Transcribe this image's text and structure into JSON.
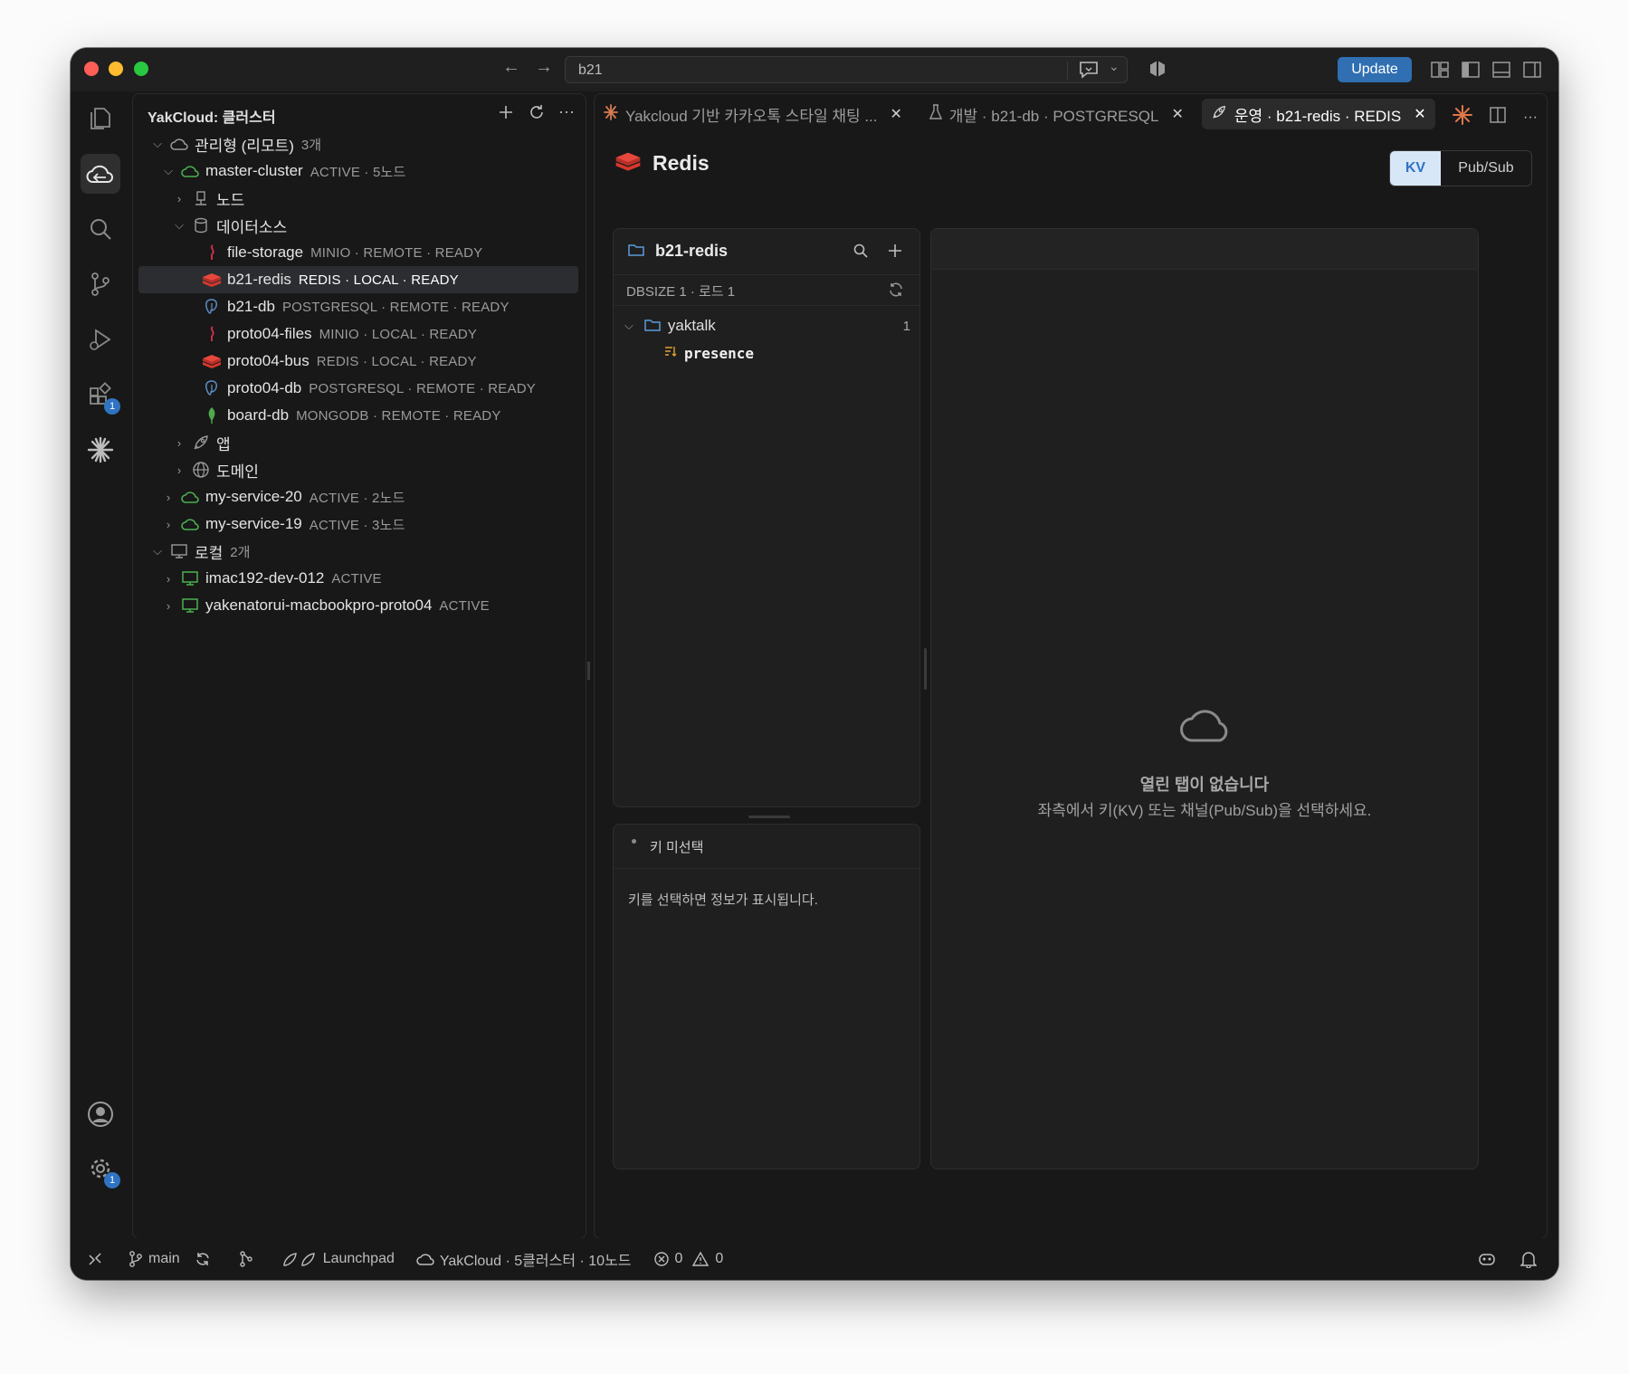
{
  "titlebar": {
    "search_query": "b21",
    "update_label": "Update"
  },
  "activity": {
    "extensions_badge": "1",
    "settings_badge": "1"
  },
  "sidebar": {
    "title": "YakCloud: 클러스터",
    "groups": {
      "managed": {
        "label": "관리형 (리모트)",
        "count": "3개"
      },
      "local": {
        "label": "로컬",
        "count": "2개"
      }
    },
    "master": {
      "name": "master-cluster",
      "meta": "ACTIVE · 5노드"
    },
    "nodes_label": "노드",
    "datasources_label": "데이터소스",
    "datasources": [
      {
        "name": "file-storage",
        "meta": "MINIO · REMOTE · READY",
        "icon": "minio-icon"
      },
      {
        "name": "b21-redis",
        "meta": "REDIS · LOCAL · READY",
        "icon": "redis-icon"
      },
      {
        "name": "b21-db",
        "meta": "POSTGRESQL · REMOTE · READY",
        "icon": "postgres-icon"
      },
      {
        "name": "proto04-files",
        "meta": "MINIO · LOCAL · READY",
        "icon": "minio-icon"
      },
      {
        "name": "proto04-bus",
        "meta": "REDIS · LOCAL · READY",
        "icon": "redis-icon"
      },
      {
        "name": "proto04-db",
        "meta": "POSTGRESQL · REMOTE · READY",
        "icon": "postgres-icon"
      },
      {
        "name": "board-db",
        "meta": "MONGODB · REMOTE · READY",
        "icon": "mongodb-icon"
      }
    ],
    "apps_label": "앱",
    "domains_label": "도메인",
    "services": [
      {
        "name": "my-service-20",
        "meta": "ACTIVE · 2노드"
      },
      {
        "name": "my-service-19",
        "meta": "ACTIVE · 3노드"
      }
    ],
    "locals": [
      {
        "name": "imac192-dev-012",
        "meta": "ACTIVE"
      },
      {
        "name": "yakenatorui-macbookpro-proto04",
        "meta": "ACTIVE"
      }
    ]
  },
  "tabs": [
    {
      "label": "Yakcloud 기반 카카오톡 스타일 채팅 ...",
      "icon": "asterisk-icon",
      "active": false
    },
    {
      "label": "개발 · b21-db · POSTGRESQL",
      "icon": "flask-icon",
      "active": false
    },
    {
      "label": "운영 · b21-redis · REDIS",
      "icon": "rocket-icon",
      "active": true
    }
  ],
  "redis": {
    "title": "Redis",
    "modes": [
      "KV",
      "Pub/Sub"
    ],
    "active_mode": "KV",
    "db_name": "b21-redis",
    "dbsize": "DBSIZE 1 · 로드 1",
    "folder": {
      "name": "yaktalk",
      "count": "1"
    },
    "key": "presence",
    "detail_header": "키 미선택",
    "detail_hint": "키를 선택하면 정보가 표시됩니다.",
    "empty_title": "열린 탭이 없습니다",
    "empty_hint": "좌측에서 키(KV) 또는 채널(Pub/Sub)을 선택하세요."
  },
  "statusbar": {
    "branch": "main",
    "launchpad": "Launchpad",
    "cloud": "YakCloud · 5클러스터 · 10노드",
    "errors": "0",
    "warnings": "0"
  },
  "colors": {
    "accent": "#2f73c3",
    "redis": "#d8382c",
    "minio": "#c72e49",
    "postgres": "#336791",
    "mongodb": "#4fa94d",
    "cloud_green": "#4caf50"
  }
}
